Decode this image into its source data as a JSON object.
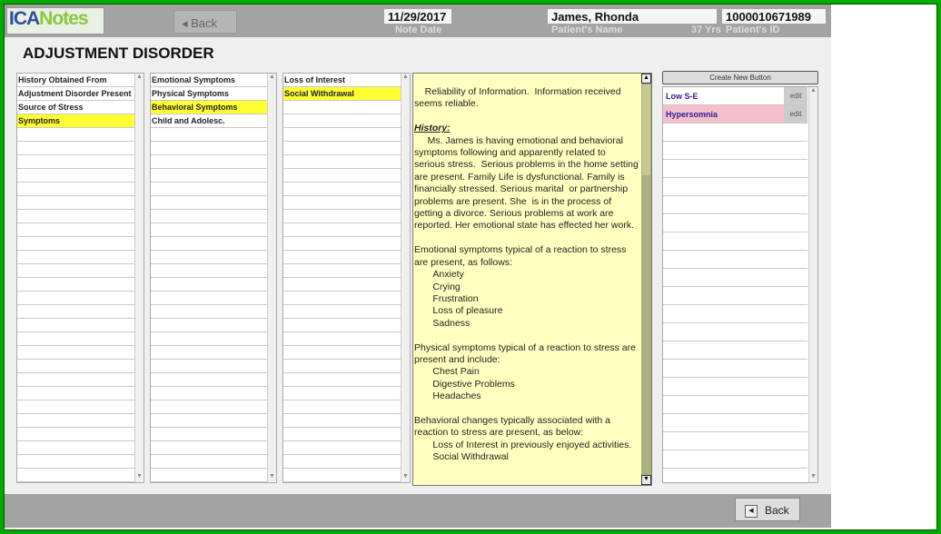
{
  "header": {
    "logo": "ICANotes",
    "back_label": "Back",
    "note_date": "11/29/2017",
    "note_date_caption": "Note Date",
    "patient_name": "James, Rhonda",
    "patient_name_caption": "Patient's Name",
    "age": "37 Yrs",
    "patient_id": "1000010671989",
    "patient_id_caption": "Patient's ID"
  },
  "page_title": "ADJUSTMENT DISORDER",
  "list1": [
    "History Obtained From",
    "Adjustment Disorder Present",
    "Source of Stress",
    "Symptoms"
  ],
  "list1_selected": 3,
  "list2": [
    "Emotional Symptoms",
    "Physical Symptoms",
    "Behavioral Symptoms",
    "Child and Adolesc."
  ],
  "list2_selected": 2,
  "list3": [
    "Loss of Interest",
    "Social Withdrawal"
  ],
  "list3_selected": 1,
  "note": {
    "p1": "    Reliability of Information.  Information received seems reliable.",
    "history_heading": "History:",
    "p2": "     Ms. James is having emotional and behavioral symptoms following and apparently related to serious stress.  Serious problems in the home setting are present. Family Life is dysfunctional. Family is financially stressed. Serious marital  or partnership problems are present. She  is in the process of getting a divorce. Serious problems at work are reported. Her emotional state has effected her work.\n\nEmotional symptoms typical of a reaction to stress are present, as follows:\n       Anxiety\n       Crying\n       Frustration\n       Loss of pleasure\n       Sadness\n\nPhysical symptoms typical of a reaction to stress are present and include:\n       Chest Pain\n       Digestive Problems\n       Headaches\n\nBehavioral changes typically associated with a reaction to stress are present, as below:\n       Loss of Interest in previously enjoyed activities.\n       Social Withdrawal"
  },
  "right_panel": {
    "create_label": "Create New  Button",
    "items": [
      {
        "label": "Low S-E",
        "edit": "edit"
      },
      {
        "label": "Hypersomnia",
        "edit": "edit"
      }
    ]
  },
  "footer": {
    "back_label": "Back"
  }
}
